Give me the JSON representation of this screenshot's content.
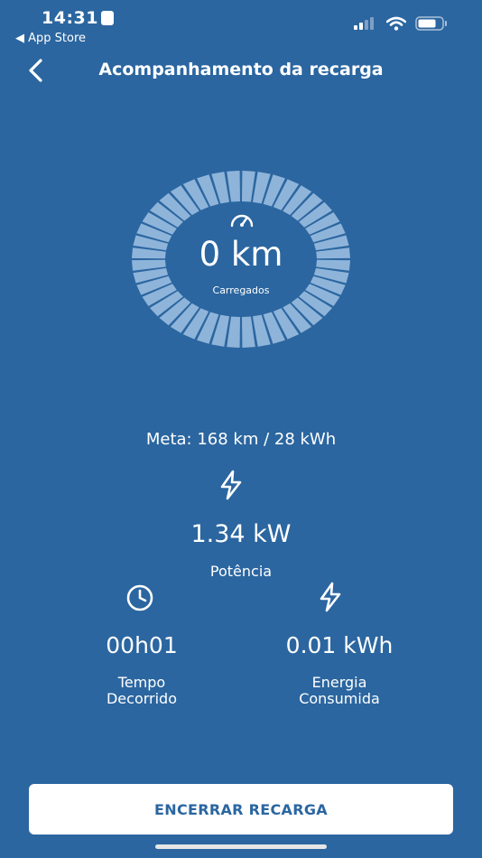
{
  "status_bar": {
    "time": "14:31",
    "back_app": "◀ App Store",
    "icons": [
      "signal-icon",
      "wifi-icon",
      "battery-icon"
    ]
  },
  "header": {
    "title": "Acompanhamento da recarga",
    "back_icon": "chevron-left-icon"
  },
  "gauge": {
    "value": "0 km",
    "label": "Carregados",
    "icon": "speedometer-icon"
  },
  "meta": "Meta: 168 km / 28 kWh",
  "power": {
    "icon": "lightning-icon",
    "value": "1.34 kW",
    "label": "Potência"
  },
  "elapsed": {
    "icon": "clock-icon",
    "value": "00h01",
    "label_line1": "Tempo",
    "label_line2": "Decorrido"
  },
  "energy": {
    "icon": "lightning-icon",
    "value": "0.01 kWh",
    "label_line1": "Energia",
    "label_line2": "Consumida"
  },
  "end_button": "ENCERRAR RECARGA",
  "colors": {
    "background": "#2b66a0",
    "segment": "#8fb4da",
    "text": "#ffffff"
  }
}
